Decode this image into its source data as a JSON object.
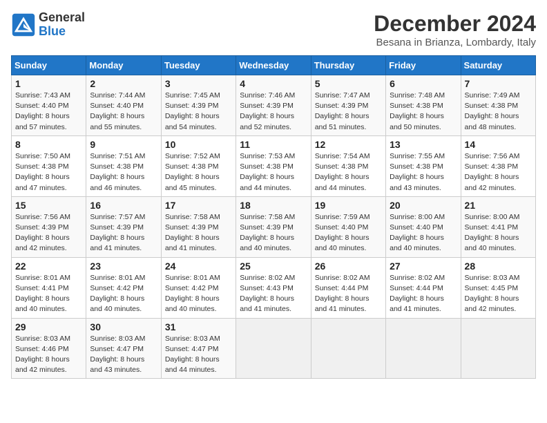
{
  "logo": {
    "line1": "General",
    "line2": "Blue"
  },
  "title": "December 2024",
  "location": "Besana in Brianza, Lombardy, Italy",
  "days_of_week": [
    "Sunday",
    "Monday",
    "Tuesday",
    "Wednesday",
    "Thursday",
    "Friday",
    "Saturday"
  ],
  "weeks": [
    [
      {
        "day": 1,
        "info": "Sunrise: 7:43 AM\nSunset: 4:40 PM\nDaylight: 8 hours\nand 57 minutes."
      },
      {
        "day": 2,
        "info": "Sunrise: 7:44 AM\nSunset: 4:40 PM\nDaylight: 8 hours\nand 55 minutes."
      },
      {
        "day": 3,
        "info": "Sunrise: 7:45 AM\nSunset: 4:39 PM\nDaylight: 8 hours\nand 54 minutes."
      },
      {
        "day": 4,
        "info": "Sunrise: 7:46 AM\nSunset: 4:39 PM\nDaylight: 8 hours\nand 52 minutes."
      },
      {
        "day": 5,
        "info": "Sunrise: 7:47 AM\nSunset: 4:39 PM\nDaylight: 8 hours\nand 51 minutes."
      },
      {
        "day": 6,
        "info": "Sunrise: 7:48 AM\nSunset: 4:38 PM\nDaylight: 8 hours\nand 50 minutes."
      },
      {
        "day": 7,
        "info": "Sunrise: 7:49 AM\nSunset: 4:38 PM\nDaylight: 8 hours\nand 48 minutes."
      }
    ],
    [
      {
        "day": 8,
        "info": "Sunrise: 7:50 AM\nSunset: 4:38 PM\nDaylight: 8 hours\nand 47 minutes."
      },
      {
        "day": 9,
        "info": "Sunrise: 7:51 AM\nSunset: 4:38 PM\nDaylight: 8 hours\nand 46 minutes."
      },
      {
        "day": 10,
        "info": "Sunrise: 7:52 AM\nSunset: 4:38 PM\nDaylight: 8 hours\nand 45 minutes."
      },
      {
        "day": 11,
        "info": "Sunrise: 7:53 AM\nSunset: 4:38 PM\nDaylight: 8 hours\nand 44 minutes."
      },
      {
        "day": 12,
        "info": "Sunrise: 7:54 AM\nSunset: 4:38 PM\nDaylight: 8 hours\nand 44 minutes."
      },
      {
        "day": 13,
        "info": "Sunrise: 7:55 AM\nSunset: 4:38 PM\nDaylight: 8 hours\nand 43 minutes."
      },
      {
        "day": 14,
        "info": "Sunrise: 7:56 AM\nSunset: 4:38 PM\nDaylight: 8 hours\nand 42 minutes."
      }
    ],
    [
      {
        "day": 15,
        "info": "Sunrise: 7:56 AM\nSunset: 4:39 PM\nDaylight: 8 hours\nand 42 minutes."
      },
      {
        "day": 16,
        "info": "Sunrise: 7:57 AM\nSunset: 4:39 PM\nDaylight: 8 hours\nand 41 minutes."
      },
      {
        "day": 17,
        "info": "Sunrise: 7:58 AM\nSunset: 4:39 PM\nDaylight: 8 hours\nand 41 minutes."
      },
      {
        "day": 18,
        "info": "Sunrise: 7:58 AM\nSunset: 4:39 PM\nDaylight: 8 hours\nand 40 minutes."
      },
      {
        "day": 19,
        "info": "Sunrise: 7:59 AM\nSunset: 4:40 PM\nDaylight: 8 hours\nand 40 minutes."
      },
      {
        "day": 20,
        "info": "Sunrise: 8:00 AM\nSunset: 4:40 PM\nDaylight: 8 hours\nand 40 minutes."
      },
      {
        "day": 21,
        "info": "Sunrise: 8:00 AM\nSunset: 4:41 PM\nDaylight: 8 hours\nand 40 minutes."
      }
    ],
    [
      {
        "day": 22,
        "info": "Sunrise: 8:01 AM\nSunset: 4:41 PM\nDaylight: 8 hours\nand 40 minutes."
      },
      {
        "day": 23,
        "info": "Sunrise: 8:01 AM\nSunset: 4:42 PM\nDaylight: 8 hours\nand 40 minutes."
      },
      {
        "day": 24,
        "info": "Sunrise: 8:01 AM\nSunset: 4:42 PM\nDaylight: 8 hours\nand 40 minutes."
      },
      {
        "day": 25,
        "info": "Sunrise: 8:02 AM\nSunset: 4:43 PM\nDaylight: 8 hours\nand 41 minutes."
      },
      {
        "day": 26,
        "info": "Sunrise: 8:02 AM\nSunset: 4:44 PM\nDaylight: 8 hours\nand 41 minutes."
      },
      {
        "day": 27,
        "info": "Sunrise: 8:02 AM\nSunset: 4:44 PM\nDaylight: 8 hours\nand 41 minutes."
      },
      {
        "day": 28,
        "info": "Sunrise: 8:03 AM\nSunset: 4:45 PM\nDaylight: 8 hours\nand 42 minutes."
      }
    ],
    [
      {
        "day": 29,
        "info": "Sunrise: 8:03 AM\nSunset: 4:46 PM\nDaylight: 8 hours\nand 42 minutes."
      },
      {
        "day": 30,
        "info": "Sunrise: 8:03 AM\nSunset: 4:47 PM\nDaylight: 8 hours\nand 43 minutes."
      },
      {
        "day": 31,
        "info": "Sunrise: 8:03 AM\nSunset: 4:47 PM\nDaylight: 8 hours\nand 44 minutes."
      },
      null,
      null,
      null,
      null
    ]
  ]
}
